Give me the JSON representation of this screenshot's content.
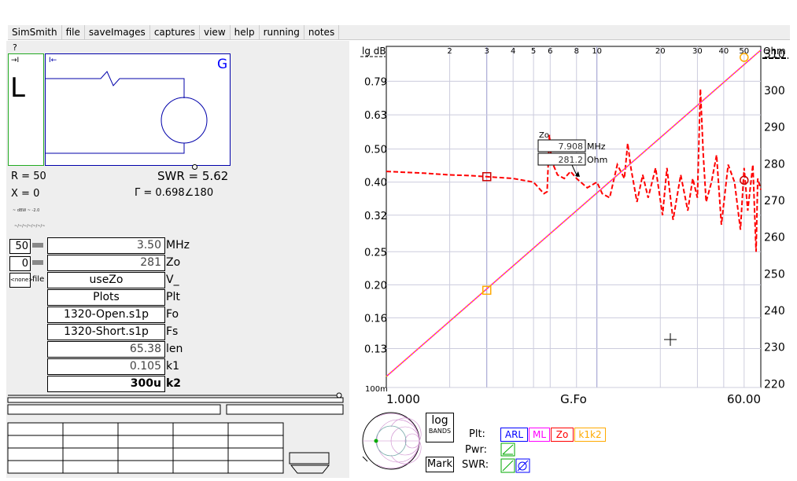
{
  "menu": [
    "SimSmith",
    "file",
    "saveImages",
    "captures",
    "view",
    "help",
    "running",
    "notes"
  ],
  "help_mark": "?",
  "schematic": {
    "left_label": "L",
    "right_label": "G",
    "arrow_left": "→I",
    "arrow_right": "I←"
  },
  "readout": {
    "r": "R = 50",
    "swr": "SWR = 5.62",
    "x": "X = 0",
    "gamma": "Γ = 0.698∠180",
    "tiny1": "~ dBW ~ -2.0",
    "tiny2": "~/~/~/~/~/~/~"
  },
  "controls": {
    "zo_val": "50",
    "zero_val": "0",
    "none_label": "<none>",
    "file_label": "file"
  },
  "params": [
    {
      "value": "3.50",
      "label": "MHz",
      "style": "r"
    },
    {
      "value": "281",
      "label": "Zo",
      "style": "r"
    },
    {
      "value": "useZo",
      "label": "V_",
      "style": "c"
    },
    {
      "value": "Plots",
      "label": "Plt",
      "style": "c"
    },
    {
      "value": "1320-Open.s1p",
      "label": "Fo",
      "style": "c"
    },
    {
      "value": "1320-Short.s1p",
      "label": "Fs",
      "style": "c"
    },
    {
      "value": "65.38",
      "label": "len",
      "style": "r"
    },
    {
      "value": "0.105",
      "label": "k1",
      "style": "r"
    },
    {
      "value": "300u",
      "label": "k2",
      "style": "b"
    }
  ],
  "chart_data": {
    "type": "line",
    "left_axis_title": "lg dB",
    "right_axis_title": "Ohm",
    "x_title": "G.Fo",
    "x_min_label": "1.000",
    "x_max_label": "60.00",
    "xlim": [
      1,
      60
    ],
    "x_ticks": [
      2,
      3,
      4,
      5,
      6,
      8,
      10,
      20,
      30,
      40,
      50
    ],
    "x_tick_labels": [
      "2",
      "3",
      "4",
      "5",
      "6",
      "8",
      "10",
      "20",
      "30",
      "40",
      "50"
    ],
    "left_ticks": [
      "0.79",
      "0.63",
      "0.50",
      "0.40",
      "0.32",
      "0.25",
      "0.20",
      "0.16",
      "0.13",
      "100m"
    ],
    "left_tick_values": [
      0.79,
      0.63,
      0.5,
      0.4,
      0.32,
      0.25,
      0.2,
      0.16,
      0.13,
      0.1
    ],
    "ylim_left": [
      0.1,
      1.0
    ],
    "right_ticks": [
      "310",
      "300",
      "290",
      "280",
      "270",
      "260",
      "250",
      "240",
      "230",
      "220"
    ],
    "right_tick_values": [
      310,
      300,
      290,
      280,
      270,
      260,
      250,
      240,
      230,
      220
    ],
    "ylim_right": [
      219,
      312
    ],
    "series": [
      {
        "color": "#ff0000",
        "dashed": true,
        "axis": "left",
        "x": [
          1,
          1.5,
          2,
          2.5,
          3,
          4,
          5,
          5.6,
          5.8,
          5.95,
          6.05,
          6.2,
          6.5,
          7,
          7.5,
          8,
          9,
          10,
          10.6,
          11.5,
          12.5,
          13.5,
          14,
          14.5,
          15.5,
          16.5,
          17.5,
          19,
          20.5,
          21.5,
          23,
          25,
          27,
          28.5,
          30,
          31,
          32,
          33,
          35,
          37,
          39,
          42,
          45,
          48,
          50,
          52,
          55,
          57,
          58,
          60
        ],
        "y": [
          0.43,
          0.425,
          0.42,
          0.418,
          0.415,
          0.41,
          0.4,
          0.37,
          0.375,
          0.55,
          0.48,
          0.45,
          0.42,
          0.41,
          0.43,
          0.41,
          0.385,
          0.4,
          0.37,
          0.36,
          0.45,
          0.41,
          0.52,
          0.44,
          0.35,
          0.42,
          0.36,
          0.44,
          0.32,
          0.44,
          0.31,
          0.42,
          0.33,
          0.41,
          0.36,
          0.75,
          0.48,
          0.35,
          0.4,
          0.48,
          0.3,
          0.45,
          0.4,
          0.29,
          0.44,
          0.33,
          0.45,
          0.25,
          0.41,
          0.38
        ]
      },
      {
        "color": "#ff00ff",
        "dashed": false,
        "axis": "right",
        "x": [
          1,
          60
        ],
        "y": [
          222,
          311
        ]
      },
      {
        "color": "#ffaa00",
        "dashed": true,
        "axis": "right",
        "x": [
          1,
          60
        ],
        "y": [
          222,
          311
        ]
      }
    ],
    "markers": [
      {
        "color": "#cc0000",
        "shape": "square",
        "x": 3,
        "y": 0.415,
        "axis": "left"
      },
      {
        "color": "#cc0000",
        "shape": "circle",
        "x": 50,
        "y": 0.405,
        "axis": "left"
      },
      {
        "color": "#ffaa00",
        "shape": "square",
        "x": 3,
        "y": 245.5,
        "axis": "right"
      },
      {
        "color": "#ffaa00",
        "shape": "circle",
        "x": 50,
        "y": 309,
        "axis": "right"
      }
    ],
    "tooltip": {
      "title": "Zo",
      "freq": "7.908",
      "freq_unit": "MHz",
      "val": "281.2",
      "val_unit": "Ohm"
    }
  },
  "bottom": {
    "log": "log",
    "bands": "BANDS",
    "mark": "Mark",
    "plt_label": "Plt:",
    "pwr_label": "Pwr:",
    "swr_label": "SWR:",
    "plt_buttons": [
      {
        "label": "ARL",
        "color": "#0000ff"
      },
      {
        "label": "ML",
        "color": "#ff00ff"
      },
      {
        "label": "Zo",
        "color": "#ff0000"
      },
      {
        "label": "k1k2",
        "color": "#ffaa00"
      }
    ]
  }
}
